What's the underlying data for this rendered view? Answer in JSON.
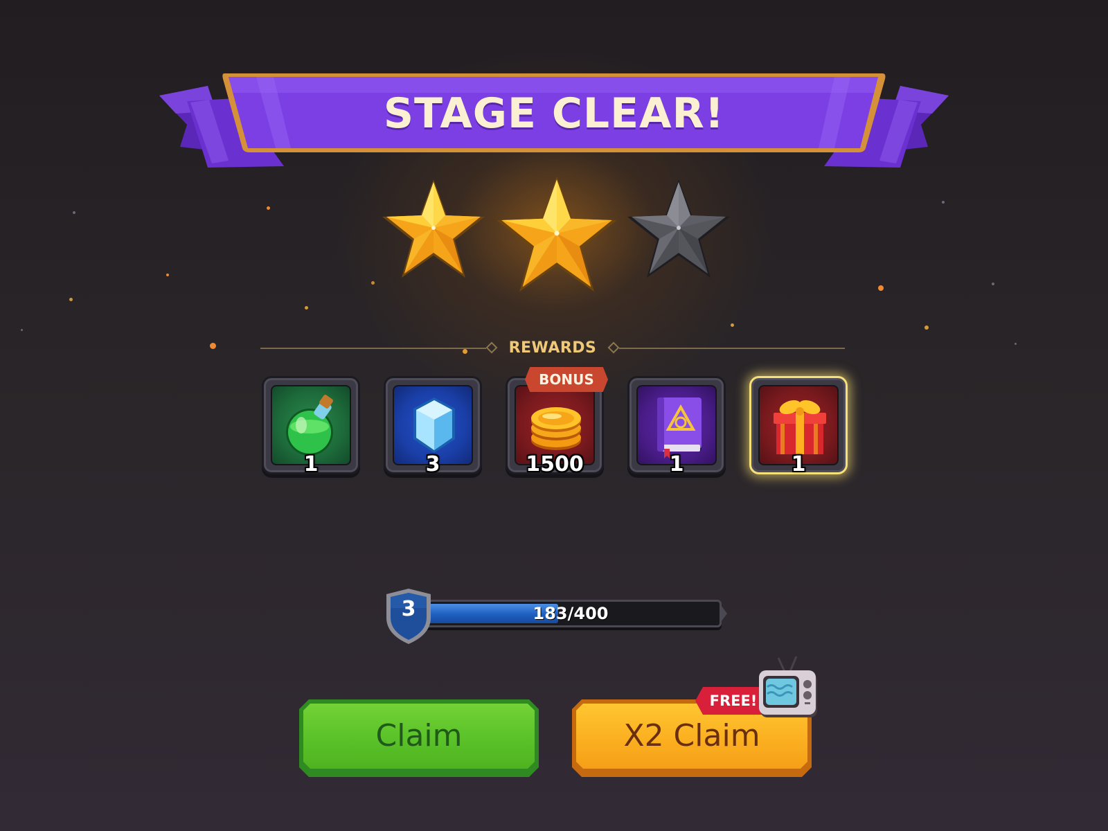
{
  "title": "STAGE CLEAR!",
  "stars": {
    "earned": 2,
    "total": 3
  },
  "rewards_label": "REWARDS",
  "rewards": [
    {
      "icon": "potion-icon",
      "count": "1",
      "bg": "#1d6a3a"
    },
    {
      "icon": "gem-icon",
      "count": "3",
      "bg": "#1a3fa8"
    },
    {
      "icon": "coins-icon",
      "count": "1500",
      "bg": "#7a1a1e",
      "badge": "BONUS"
    },
    {
      "icon": "spellbook-icon",
      "count": "1",
      "bg": "#4a1d8a"
    },
    {
      "icon": "gift-icon",
      "count": "1",
      "bg": "#7a1a1e",
      "highlighted": true
    }
  ],
  "level": {
    "number": "3",
    "xp_current": "183",
    "xp_max": "400",
    "xp_text": "183/400",
    "progress": 0.4575
  },
  "buttons": {
    "claim_label": "Claim",
    "x2_claim_label": "X2 Claim",
    "free_badge": "FREE!"
  },
  "colors": {
    "banner": "#7b3fe4",
    "star_gold": "#f9b81e",
    "star_locked": "#5a5a60",
    "claim_green": "#5cc32a",
    "x2_orange": "#fbb020",
    "xp_blue": "#2a6fd0",
    "free_red": "#d8203a"
  }
}
